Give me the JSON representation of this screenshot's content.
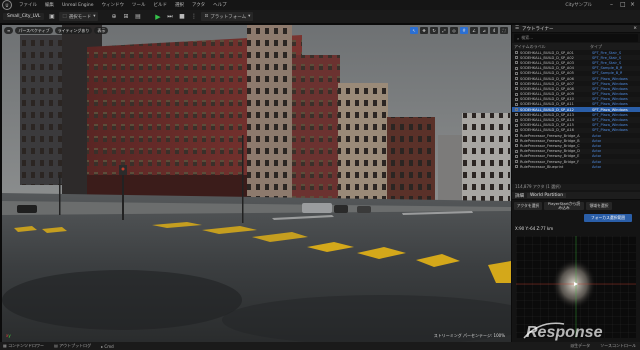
{
  "menubar": {
    "logo": "U",
    "items": [
      "ファイル",
      "編集",
      "Unreal Engine",
      "ウィンドウ",
      "ツール",
      "ビルド",
      "選択",
      "アクタ",
      "ヘルプ"
    ],
    "project_name": "Small_City_LVL",
    "right_title": "Cityサンプル"
  },
  "toolbar": {
    "mode_label": "選択モード",
    "platform_label": "プラットフォーム"
  },
  "viewport": {
    "perspective_label": "パースペクティブ",
    "lit_label": "ライティングあり",
    "show_label": "表示",
    "camera_speed": "4",
    "perf_text": "ストリーミング パーセンテージ: 100%"
  },
  "outliner": {
    "tab_label": "アウトライナー",
    "search_placeholder": "検索...",
    "col_label": "アイテムのラベル",
    "col_type": "タイプ",
    "rows": [
      {
        "name": "SODEHKALL_BUILD_D_SP_A01",
        "type": "SPT_Fire_Stair_S",
        "sel": false
      },
      {
        "name": "SODEHKALL_BUILD_D_SP_A02",
        "type": "SPT_Fire_Stair_S",
        "sel": false
      },
      {
        "name": "SODEHKALL_BUILD_D_SP_A03",
        "type": "SPT_Fire_Stair_S",
        "sel": false
      },
      {
        "name": "SODEHKALL_BUILD_D_SP_A04",
        "type": "SPT_Sample_B_R",
        "sel": false
      },
      {
        "name": "SODEHKALL_BUILD_D_SP_A05",
        "type": "SPT_Sample_B_R",
        "sel": false
      },
      {
        "name": "SODEHKALL_BUILD_D_SP_A06",
        "type": "SPT_Plaza_Windows",
        "sel": false
      },
      {
        "name": "SODEHKALL_BUILD_D_SP_A07",
        "type": "SPT_Plaza_Windows",
        "sel": false
      },
      {
        "name": "SODEHKALL_BUILD_D_SP_A08",
        "type": "SPT_Plaza_Windows",
        "sel": false
      },
      {
        "name": "SODEHKALL_BUILD_D_SP_A09",
        "type": "SPT_Plaza_Windows",
        "sel": false
      },
      {
        "name": "SODEHKALL_BUILD_D_SP_A10",
        "type": "SPT_Plaza_Windows",
        "sel": false
      },
      {
        "name": "SODEHKALL_BUILD_D_SP_A11",
        "type": "SPT_Plaza_Windows",
        "sel": false
      },
      {
        "name": "SODEHKALL_BUILD_D_SP_A12",
        "type": "SPT_Plaza_Windows",
        "sel": true
      },
      {
        "name": "SODEHKALL_BUILD_D_SP_A13",
        "type": "SPT_Plaza_Windows",
        "sel": false
      },
      {
        "name": "SODEHKALL_BUILD_D_SP_A14",
        "type": "SPT_Plaza_Windows",
        "sel": false
      },
      {
        "name": "SODEHKALL_BUILD_D_SP_A15",
        "type": "SPT_Plaza_Windows",
        "sel": false
      },
      {
        "name": "SODEHKALL_BUILD_D_SP_A16",
        "type": "SPT_Plaza_Windows",
        "sel": false
      },
      {
        "name": "RulePrecessor_Freeway_Bridge_A",
        "type": "Actor",
        "sel": false
      },
      {
        "name": "RulePrecessor_Freeway_Bridge_B",
        "type": "Actor",
        "sel": false
      },
      {
        "name": "RulePrecessor_Freeway_Bridge_C",
        "type": "Actor",
        "sel": false
      },
      {
        "name": "RulePrecessor_Freeway_Bridge_D",
        "type": "Actor",
        "sel": false
      },
      {
        "name": "RulePrecessor_Freeway_Bridge_E",
        "type": "Actor",
        "sel": false
      },
      {
        "name": "RulePrecessor_Freeway_Bridge_F",
        "type": "Actor",
        "sel": false
      },
      {
        "name": "RulePrecessor_Blueprint",
        "type": "Actor",
        "sel": false
      }
    ],
    "footer": "114,879 アクタ (1 選択)"
  },
  "details": {
    "tab_details": "詳細",
    "tab_world": "World Partition",
    "btn_load": "アクタを選択",
    "btn_unload": "PlayerStartから読み込み",
    "btn_region": "領域を選択",
    "btn_snapshot": "フォーカス選択範囲",
    "coord_text": "X:90 Y:-64 Z:77 km"
  },
  "status": {
    "content_drawer": "コンテンツドロワー",
    "output_log": "アウトプットログ",
    "cmd": "Cmd",
    "source_control": "ソースコントロール",
    "derived": "派生データ"
  },
  "watermark": {
    "text": "Response"
  }
}
